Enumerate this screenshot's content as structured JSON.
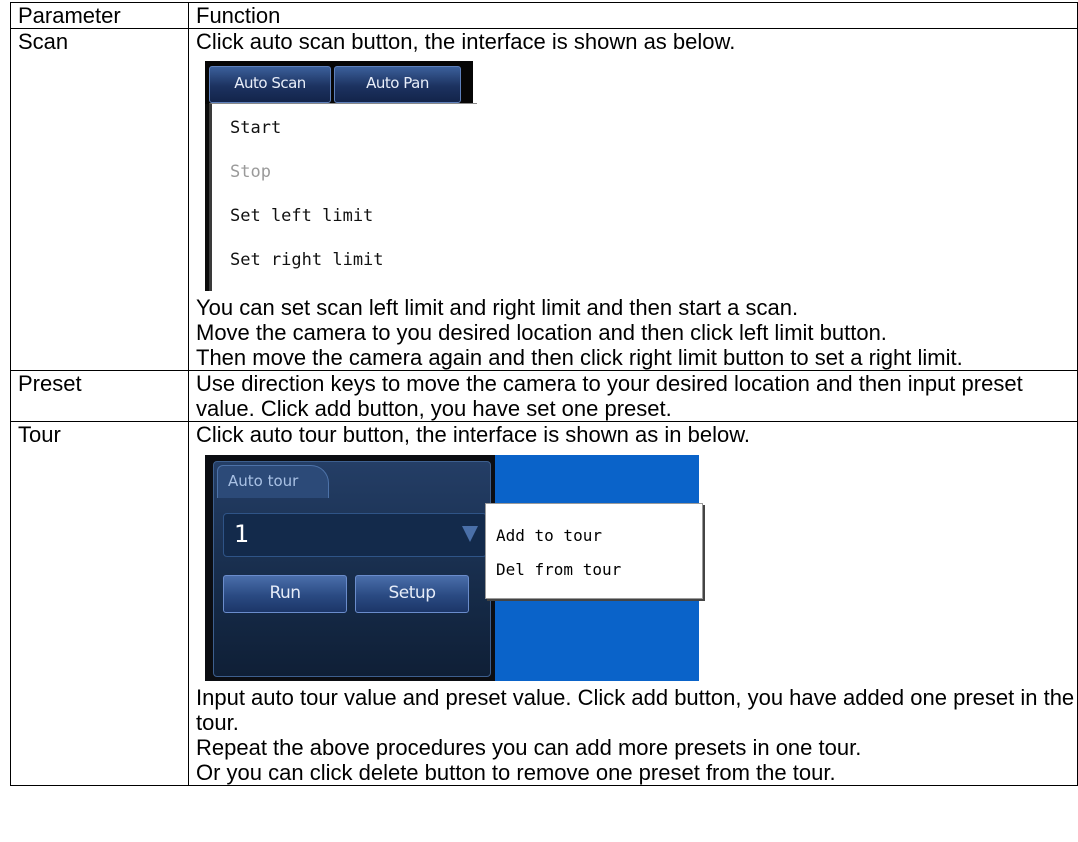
{
  "table": {
    "header": {
      "col1": "Parameter",
      "col2": "Function"
    },
    "rows": [
      {
        "param": "Scan",
        "intro": "Click auto scan button, the interface is shown as below.",
        "screenshot": {
          "buttons": [
            "Auto Scan",
            "Auto Pan"
          ],
          "menu": [
            {
              "label": "Start",
              "enabled": true
            },
            {
              "label": "Stop",
              "enabled": false
            },
            {
              "label": "Set left limit",
              "enabled": true
            },
            {
              "label": "Set right limit",
              "enabled": true
            }
          ]
        },
        "paragraphs": [
          "You can set scan left limit and right limit and then start a scan.",
          "Move the camera to you desired location and then click left limit button.",
          "Then move the camera again and then click right limit button to set a right limit."
        ]
      },
      {
        "param": "Preset",
        "paragraphs": [
          "Use direction keys to move the camera to your desired location and then input preset value. Click add button, you have set one preset."
        ]
      },
      {
        "param": "Tour",
        "intro": "Click auto tour button, the interface is shown as in below.",
        "screenshot": {
          "tab": "Auto tour",
          "select_value": "1",
          "buttons": [
            "Run",
            "Setup"
          ],
          "menu": [
            "Add to tour",
            "Del from tour"
          ],
          "colors": {
            "background": "#0a63c9",
            "panel": "#142844"
          }
        },
        "paragraphs": [
          "Input auto tour value and preset value. Click add button, you have added one preset in the tour.",
          "Repeat the above procedures you can add more presets in one tour.",
          "Or you can click delete button to remove one preset from the tour."
        ]
      }
    ]
  }
}
